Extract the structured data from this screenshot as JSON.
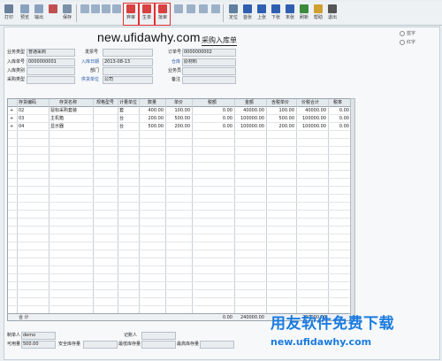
{
  "toolbar": {
    "buttons": [
      {
        "label": "打印",
        "color": "#6a7f9a"
      },
      {
        "label": "预览",
        "color": "#8aa2bf"
      },
      {
        "label": "输出",
        "color": "#8aa2bf"
      },
      {
        "label": "",
        "color": "#c05050"
      },
      {
        "label": "保存",
        "color": "#7c90a8"
      },
      {
        "label": "",
        "color": "#9cb1c8"
      },
      {
        "label": "",
        "color": "#9cb1c8"
      },
      {
        "label": "",
        "color": "#9cb1c8"
      },
      {
        "label": "",
        "color": "#9cb1c8"
      },
      {
        "label": "弃审",
        "color": "#d94040"
      },
      {
        "label": "生单",
        "color": "#d94040"
      },
      {
        "label": "批审",
        "color": "#d94040"
      },
      {
        "label": "",
        "color": "#9cb1c8"
      },
      {
        "label": "",
        "color": "#9cb1c8"
      },
      {
        "label": "",
        "color": "#9cb1c8"
      },
      {
        "label": "",
        "color": "#9cb1c8"
      },
      {
        "label": "定位",
        "color": "#5f7fa0"
      },
      {
        "label": "首张",
        "color": "#2f5fb0"
      },
      {
        "label": "上张",
        "color": "#2f5fb0"
      },
      {
        "label": "下张",
        "color": "#2f5fb0"
      },
      {
        "label": "末张",
        "color": "#2f5fb0"
      },
      {
        "label": "刷新",
        "color": "#3c8a3c"
      },
      {
        "label": "帮助",
        "color": "#d0a030"
      },
      {
        "label": "退出",
        "color": "#555555"
      }
    ]
  },
  "watermark": "new.ufidawhy.com",
  "document_title": "采购入库单",
  "legend": [
    "蓝字",
    "红字"
  ],
  "header_fields": {
    "business_type_label": "业务类型",
    "business_type_value": "普通采购",
    "receipt_no_label": "入库单号",
    "receipt_no_value": "0000000001",
    "warehouse_label": "入库类别",
    "warehouse_value": "",
    "purchase_type_label": "采购类型",
    "purchase_type_value": "",
    "invoice_label": "发票号",
    "invoice_value": "",
    "date_label": "入库日期",
    "date_value": "2013-08-13",
    "dept_label": "部门",
    "dept_value": "",
    "supplier_label": "供货单位",
    "supplier_value": "公司",
    "order_label": "订单号",
    "order_value": "0000000002",
    "store_label": "仓库",
    "store_value": "原材料",
    "salesman_label": "业务员",
    "salesman_value": "",
    "note_label": "备注",
    "note_value": ""
  },
  "grid": {
    "columns": [
      "存货编码",
      "存货名称",
      "规格型号",
      "计量单位",
      "数量",
      "单价",
      "税额",
      "金额",
      "含税单价",
      "价税合计",
      "税率"
    ],
    "rows": [
      [
        "02",
        "鼠标采购套装",
        "",
        "套",
        "400.00",
        "100.00",
        "0.00",
        "40000.00",
        "100.00",
        "40000.00",
        "0.00"
      ],
      [
        "03",
        "主机箱",
        "",
        "台",
        "200.00",
        "500.00",
        "0.00",
        "100000.00",
        "500.00",
        "100000.00",
        "0.00"
      ],
      [
        "04",
        "显示器",
        "",
        "台",
        "500.00",
        "200.00",
        "0.00",
        "100000.00",
        "200.00",
        "100000.00",
        "0.00"
      ]
    ],
    "total_label": "合 计",
    "total_tax": "0.00",
    "total_amount": "240000.00",
    "total_sum": "240000.00"
  },
  "footer": {
    "maker_label": "制单人",
    "maker_value": "demo",
    "bookkeeper_label": "记账人",
    "bookkeeper_value": "",
    "available_label": "可用量",
    "available_value": "500.00",
    "safety_label": "安全库存量",
    "safety_value": "",
    "min_label": "最低库存量",
    "min_value": "",
    "max_label": "最高库存量",
    "max_value": ""
  },
  "brand": {
    "text": "用友软件免费下载",
    "url": "new.ufidawhy.com"
  }
}
